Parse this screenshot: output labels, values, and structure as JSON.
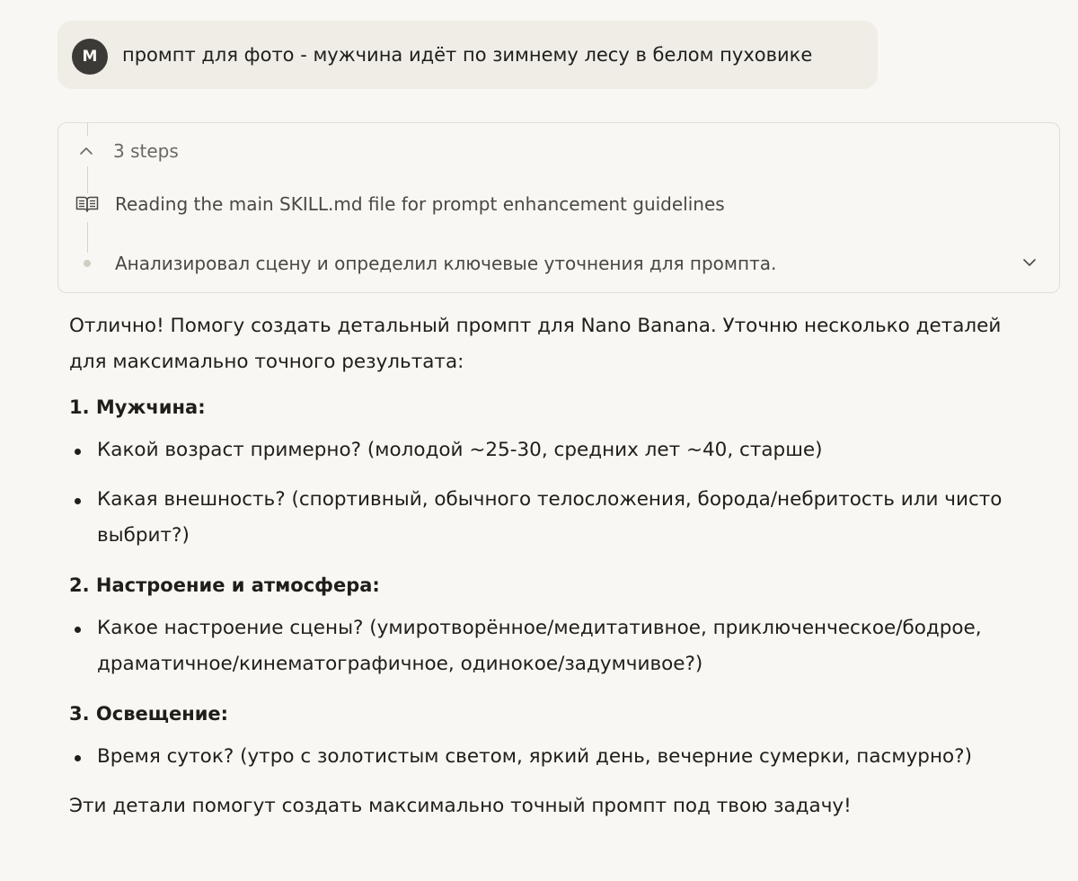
{
  "user_message": {
    "avatar_initial": "M",
    "text": "промпт для фото - мужчина идёт по зимнему лесу в белом пуховике"
  },
  "steps": {
    "toggle_label": "3 steps",
    "items": [
      {
        "icon": "book-icon",
        "text": "Reading the main SKILL.md file for prompt enhancement guidelines"
      },
      {
        "icon": "dot-icon",
        "text": "Анализировал сцену и определил ключевые уточнения для промпта."
      }
    ]
  },
  "answer": {
    "intro": "Отлично! Помогу создать детальный промпт для Nano Banana. Уточню несколько деталей для максимально точного результата:",
    "sections": [
      {
        "title": "1. Мужчина:",
        "bullets": [
          "Какой возраст примерно? (молодой ~25-30, средних лет ~40, старше)",
          "Какая внешность? (спортивный, обычного телосложения, борода/небритость или чисто выбрит?)"
        ]
      },
      {
        "title": "2. Настроение и атмосфера:",
        "bullets": [
          "Какое настроение сцены? (умиротворённое/медитативное, приключенческое/бодрое, драматичное/кинематографичное, одинокое/задумчивое?)"
        ]
      },
      {
        "title": "3. Освещение:",
        "bullets": [
          "Время суток? (утро с золотистым светом, яркий день, вечерние сумерки, пасмурно?)"
        ]
      }
    ],
    "outro": "Эти детали помогут создать максимально точный промпт под твою задачу!"
  }
}
